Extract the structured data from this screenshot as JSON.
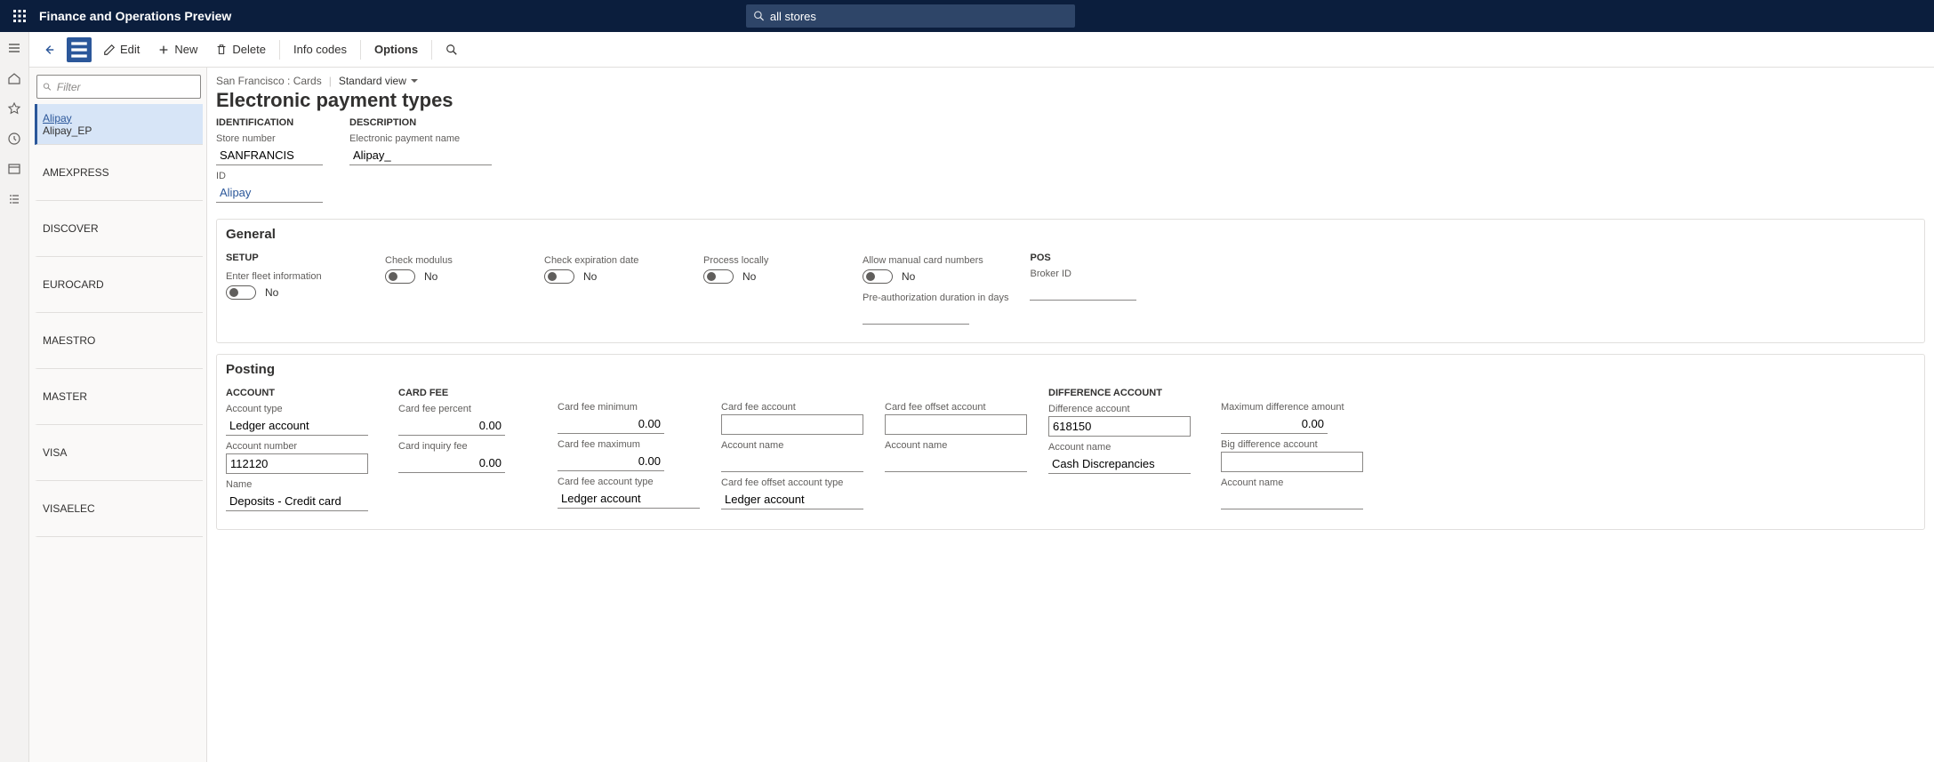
{
  "app_title": "Finance and Operations Preview",
  "search_value": "all stores",
  "actions": {
    "edit": "Edit",
    "new": "New",
    "delete": "Delete",
    "info_codes": "Info codes",
    "options": "Options"
  },
  "filter_placeholder": "Filter",
  "list": [
    {
      "l1": "Alipay",
      "l2": "Alipay_EP",
      "selected": true,
      "link": true
    },
    {
      "l1": "AMEXPRESS"
    },
    {
      "l1": "DISCOVER"
    },
    {
      "l1": "EUROCARD"
    },
    {
      "l1": "MAESTRO"
    },
    {
      "l1": "MASTER"
    },
    {
      "l1": "VISA"
    },
    {
      "l1": "VISAELEC"
    }
  ],
  "breadcrumb": "San Francisco : Cards",
  "view": "Standard view",
  "page_title": "Electronic payment types",
  "identification": {
    "heading": "IDENTIFICATION",
    "store_number_lbl": "Store number",
    "store_number": "SANFRANCIS",
    "id_lbl": "ID",
    "id": "Alipay"
  },
  "description": {
    "heading": "DESCRIPTION",
    "name_lbl": "Electronic payment name",
    "name": "Alipay_"
  },
  "general": {
    "heading": "General",
    "setup": "SETUP",
    "fleet_lbl": "Enter fleet information",
    "fleet": "No",
    "modulus_lbl": "Check modulus",
    "modulus": "No",
    "expiry_lbl": "Check expiration date",
    "expiry": "No",
    "local_lbl": "Process locally",
    "local": "No",
    "manual_lbl": "Allow manual card numbers",
    "manual": "No",
    "preauth_lbl": "Pre-authorization duration in days",
    "preauth": "",
    "pos": "POS",
    "broker_lbl": "Broker ID",
    "broker": ""
  },
  "posting": {
    "heading": "Posting",
    "account_hdr": "ACCOUNT",
    "account_type_lbl": "Account type",
    "account_type": "Ledger account",
    "account_number_lbl": "Account number",
    "account_number": "112120",
    "name_lbl": "Name",
    "name": "Deposits - Credit card",
    "cardfee_hdr": "CARD FEE",
    "fee_pct_lbl": "Card fee percent",
    "fee_pct": "0.00",
    "inquiry_lbl": "Card inquiry fee",
    "inquiry": "0.00",
    "fee_min_lbl": "Card fee minimum",
    "fee_min": "0.00",
    "fee_max_lbl": "Card fee maximum",
    "fee_max": "0.00",
    "fee_acct_type_lbl": "Card fee account type",
    "fee_acct_type": "Ledger account",
    "fee_acct_lbl": "Card fee account",
    "fee_acct": "",
    "acct_name_lbl": "Account name",
    "acct_name_a": "",
    "fee_offset_acct_type_lbl": "Card fee offset account type",
    "fee_offset_acct_type": "Ledger account",
    "fee_offset_acct_lbl": "Card fee offset account",
    "fee_offset_acct": "",
    "acct_name_b": "",
    "diff_hdr": "DIFFERENCE ACCOUNT",
    "diff_acct_lbl": "Difference account",
    "diff_acct": "618150",
    "diff_name_lbl": "Account name",
    "diff_name": "Cash Discrepancies",
    "max_diff_lbl": "Maximum difference amount",
    "max_diff": "0.00",
    "big_diff_lbl": "Big difference account",
    "big_diff": "",
    "big_diff_name_lbl": "Account name",
    "big_diff_name": ""
  }
}
